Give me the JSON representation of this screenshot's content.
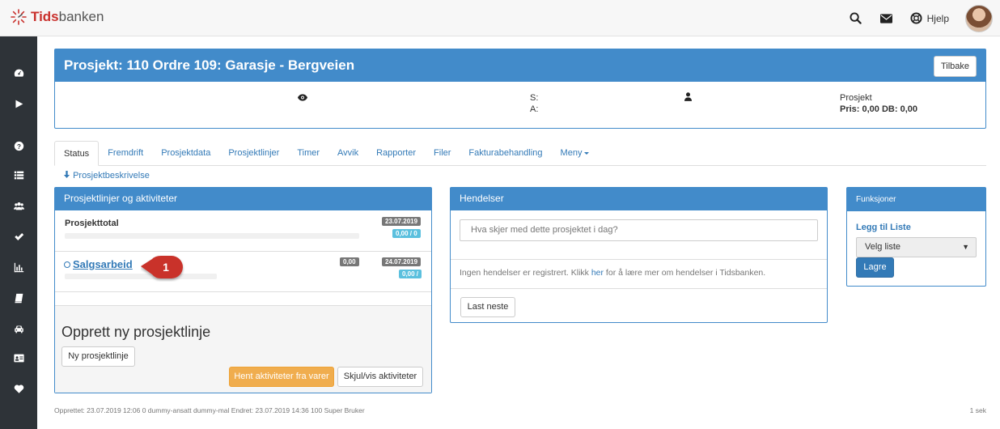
{
  "app": {
    "logo_brand": "Tids",
    "logo_rest": "banken",
    "help_label": "Hjelp"
  },
  "project": {
    "title": "Prosjekt: 110 Ordre 109: Garasje - Bergveien",
    "back_label": "Tilbake",
    "s_label": "S:",
    "a_label": "A:",
    "type_label": "Prosjekt",
    "price_label": "Pris: 0,00 DB: 0,00"
  },
  "tabs": [
    {
      "label": "Status"
    },
    {
      "label": "Fremdrift"
    },
    {
      "label": "Prosjektdata"
    },
    {
      "label": "Prosjektlinjer"
    },
    {
      "label": "Timer"
    },
    {
      "label": "Avvik"
    },
    {
      "label": "Rapporter"
    },
    {
      "label": "Filer"
    },
    {
      "label": "Fakturabehandling"
    },
    {
      "label": "Meny"
    }
  ],
  "desc_link": "Prosjektbeskrivelse",
  "lines_panel": {
    "title": "Prosjektlinjer og aktiviteter",
    "total_label": "Prosjekttotal",
    "total_date": "23.07.2019",
    "total_value": "0,00 / 0",
    "item_label": "Salgsarbeid",
    "item_amount": "0,00",
    "item_date": "24.07.2019",
    "item_value": "0,00 /",
    "callout": "1",
    "create_title": "Opprett ny prosjektlinje",
    "new_button": "Ny prosjektlinje",
    "fetch_button": "Hent aktiviteter fra varer",
    "toggle_button": "Skjul/vis aktiviteter"
  },
  "events_panel": {
    "title": "Hendelser",
    "placeholder": "Hva skjer med dette prosjektet i dag?",
    "info_before": "Ingen hendelser er registrert. Klikk ",
    "info_link": "her",
    "info_after": " for å lære mer om hendelser i Tidsbanken.",
    "load_more": "Last neste"
  },
  "functions_panel": {
    "title": "Funksjoner",
    "add_list": "Legg til Liste",
    "select_value": "Velg liste",
    "save": "Lagre"
  },
  "footer": {
    "text": "Opprettet: 23.07.2019 12:06 0 dummy-ansatt dummy-mal Endret: 23.07.2019 14:36 100 Super Bruker",
    "time": "1 sek"
  },
  "colors": {
    "primary": "#428bca",
    "sidebar": "#2e3338",
    "warning": "#f0ad4e",
    "callout": "#c9302c"
  }
}
